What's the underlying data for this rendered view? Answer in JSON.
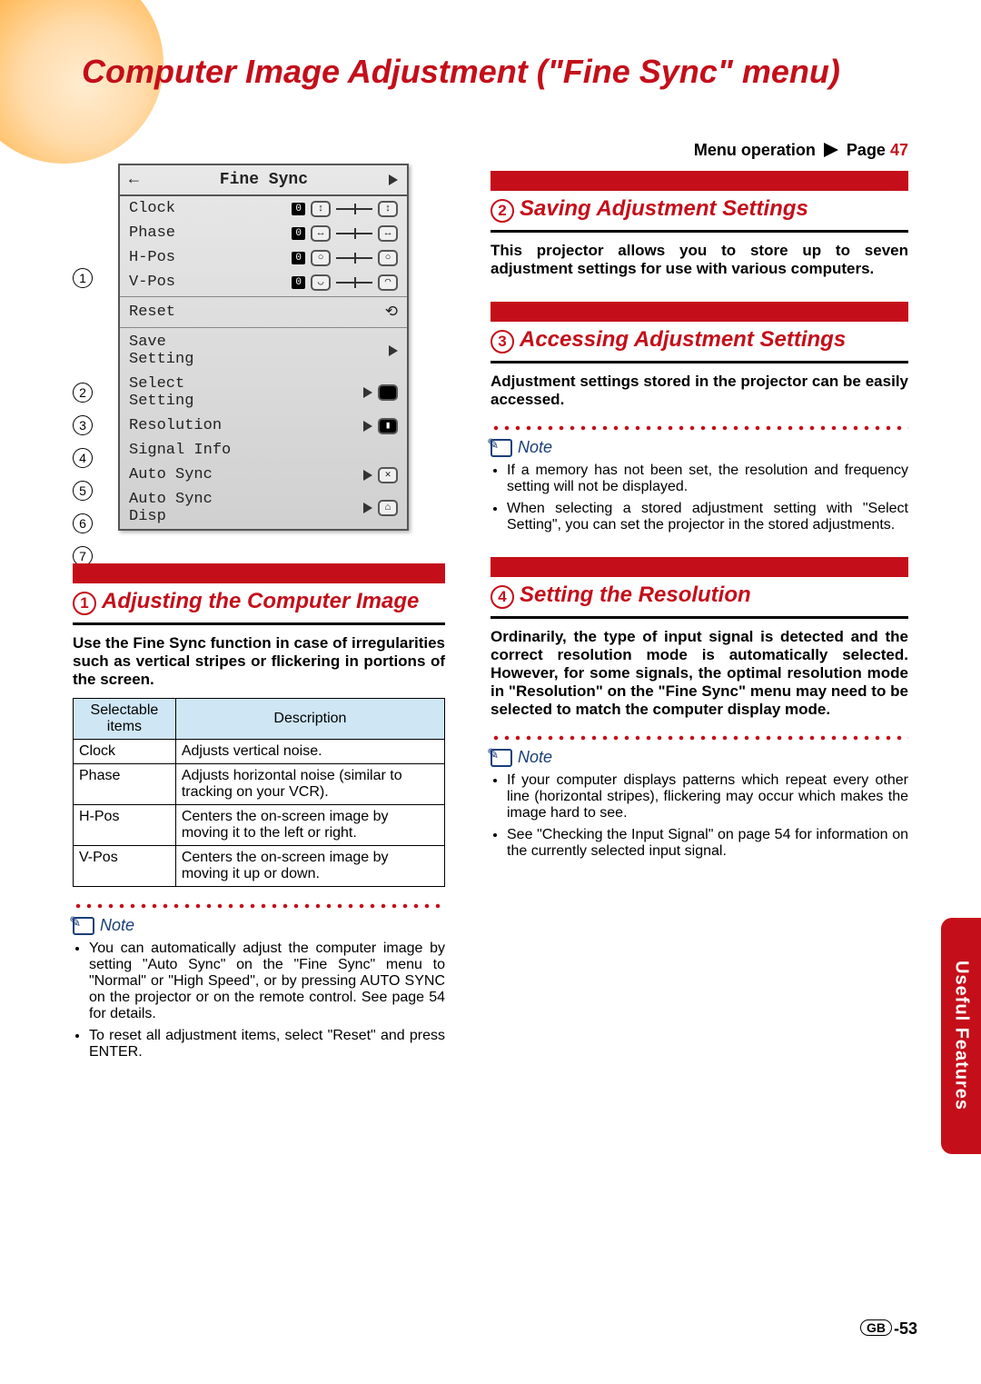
{
  "page_title": "Computer Image Adjustment (\"Fine Sync\" menu)",
  "menu_operation": {
    "label": "Menu operation",
    "page_label": "Page",
    "page_num": "47"
  },
  "osd": {
    "title": "Fine Sync",
    "items": [
      {
        "label": "Clock"
      },
      {
        "label": "Phase"
      },
      {
        "label": "H-Pos"
      },
      {
        "label": "V-Pos"
      },
      {
        "label": "Reset"
      },
      {
        "label": "Save Setting"
      },
      {
        "label": "Select Setting"
      },
      {
        "label": "Resolution"
      },
      {
        "label": "Signal Info"
      },
      {
        "label": "Auto Sync"
      },
      {
        "label": "Auto Sync Disp"
      }
    ]
  },
  "callout_numbers": [
    "1",
    "2",
    "3",
    "4",
    "5",
    "6",
    "7"
  ],
  "sections": {
    "s1": {
      "num": "1",
      "title": "Adjusting the Computer Image",
      "intro": "Use the Fine Sync function in case of irregularities such as vertical stripes or flickering in portions of the screen.",
      "table": {
        "headers": [
          "Selectable items",
          "Description"
        ],
        "rows": [
          [
            "Clock",
            "Adjusts vertical noise."
          ],
          [
            "Phase",
            "Adjusts horizontal noise (similar to tracking on your VCR)."
          ],
          [
            "H-Pos",
            "Centers the on-screen image by moving it to the left or right."
          ],
          [
            "V-Pos",
            "Centers the on-screen image by moving it up or down."
          ]
        ]
      },
      "note_label": "Note",
      "notes": [
        "You can automatically adjust the computer image by setting \"Auto Sync\" on the \"Fine Sync\" menu to \"Normal\" or \"High Speed\", or by pressing AUTO SYNC on the projector or on the remote control. See page 54 for details.",
        "To reset all adjustment items, select \"Reset\" and press ENTER."
      ]
    },
    "s2": {
      "num": "2",
      "title": "Saving Adjustment Settings",
      "intro": "This projector allows you to store up to seven adjustment settings for use with various computers."
    },
    "s3": {
      "num": "3",
      "title": "Accessing Adjustment Settings",
      "intro": "Adjustment settings stored in the projector can be easily accessed.",
      "note_label": "Note",
      "notes": [
        "If a memory has not been set, the resolution and frequency setting will not be displayed.",
        "When selecting a stored adjustment setting with \"Select Setting\", you can set the projector in the stored adjustments."
      ]
    },
    "s4": {
      "num": "4",
      "title": "Setting the Resolution",
      "intro": "Ordinarily, the type of input signal is detected and the correct resolution mode is automatically selected. However, for some signals, the optimal resolution mode in \"Resolution\" on the \"Fine Sync\" menu may need to be selected to match the computer display mode.",
      "note_label": "Note",
      "notes": [
        "If your computer displays patterns which repeat every other line (horizontal stripes), flickering may occur which makes the image hard to see.",
        "See \"Checking the Input Signal\" on page 54 for information on the currently selected input signal."
      ]
    }
  },
  "side_tab": "Useful Features",
  "page_footer": {
    "prefix": "GB",
    "num": "-53"
  }
}
